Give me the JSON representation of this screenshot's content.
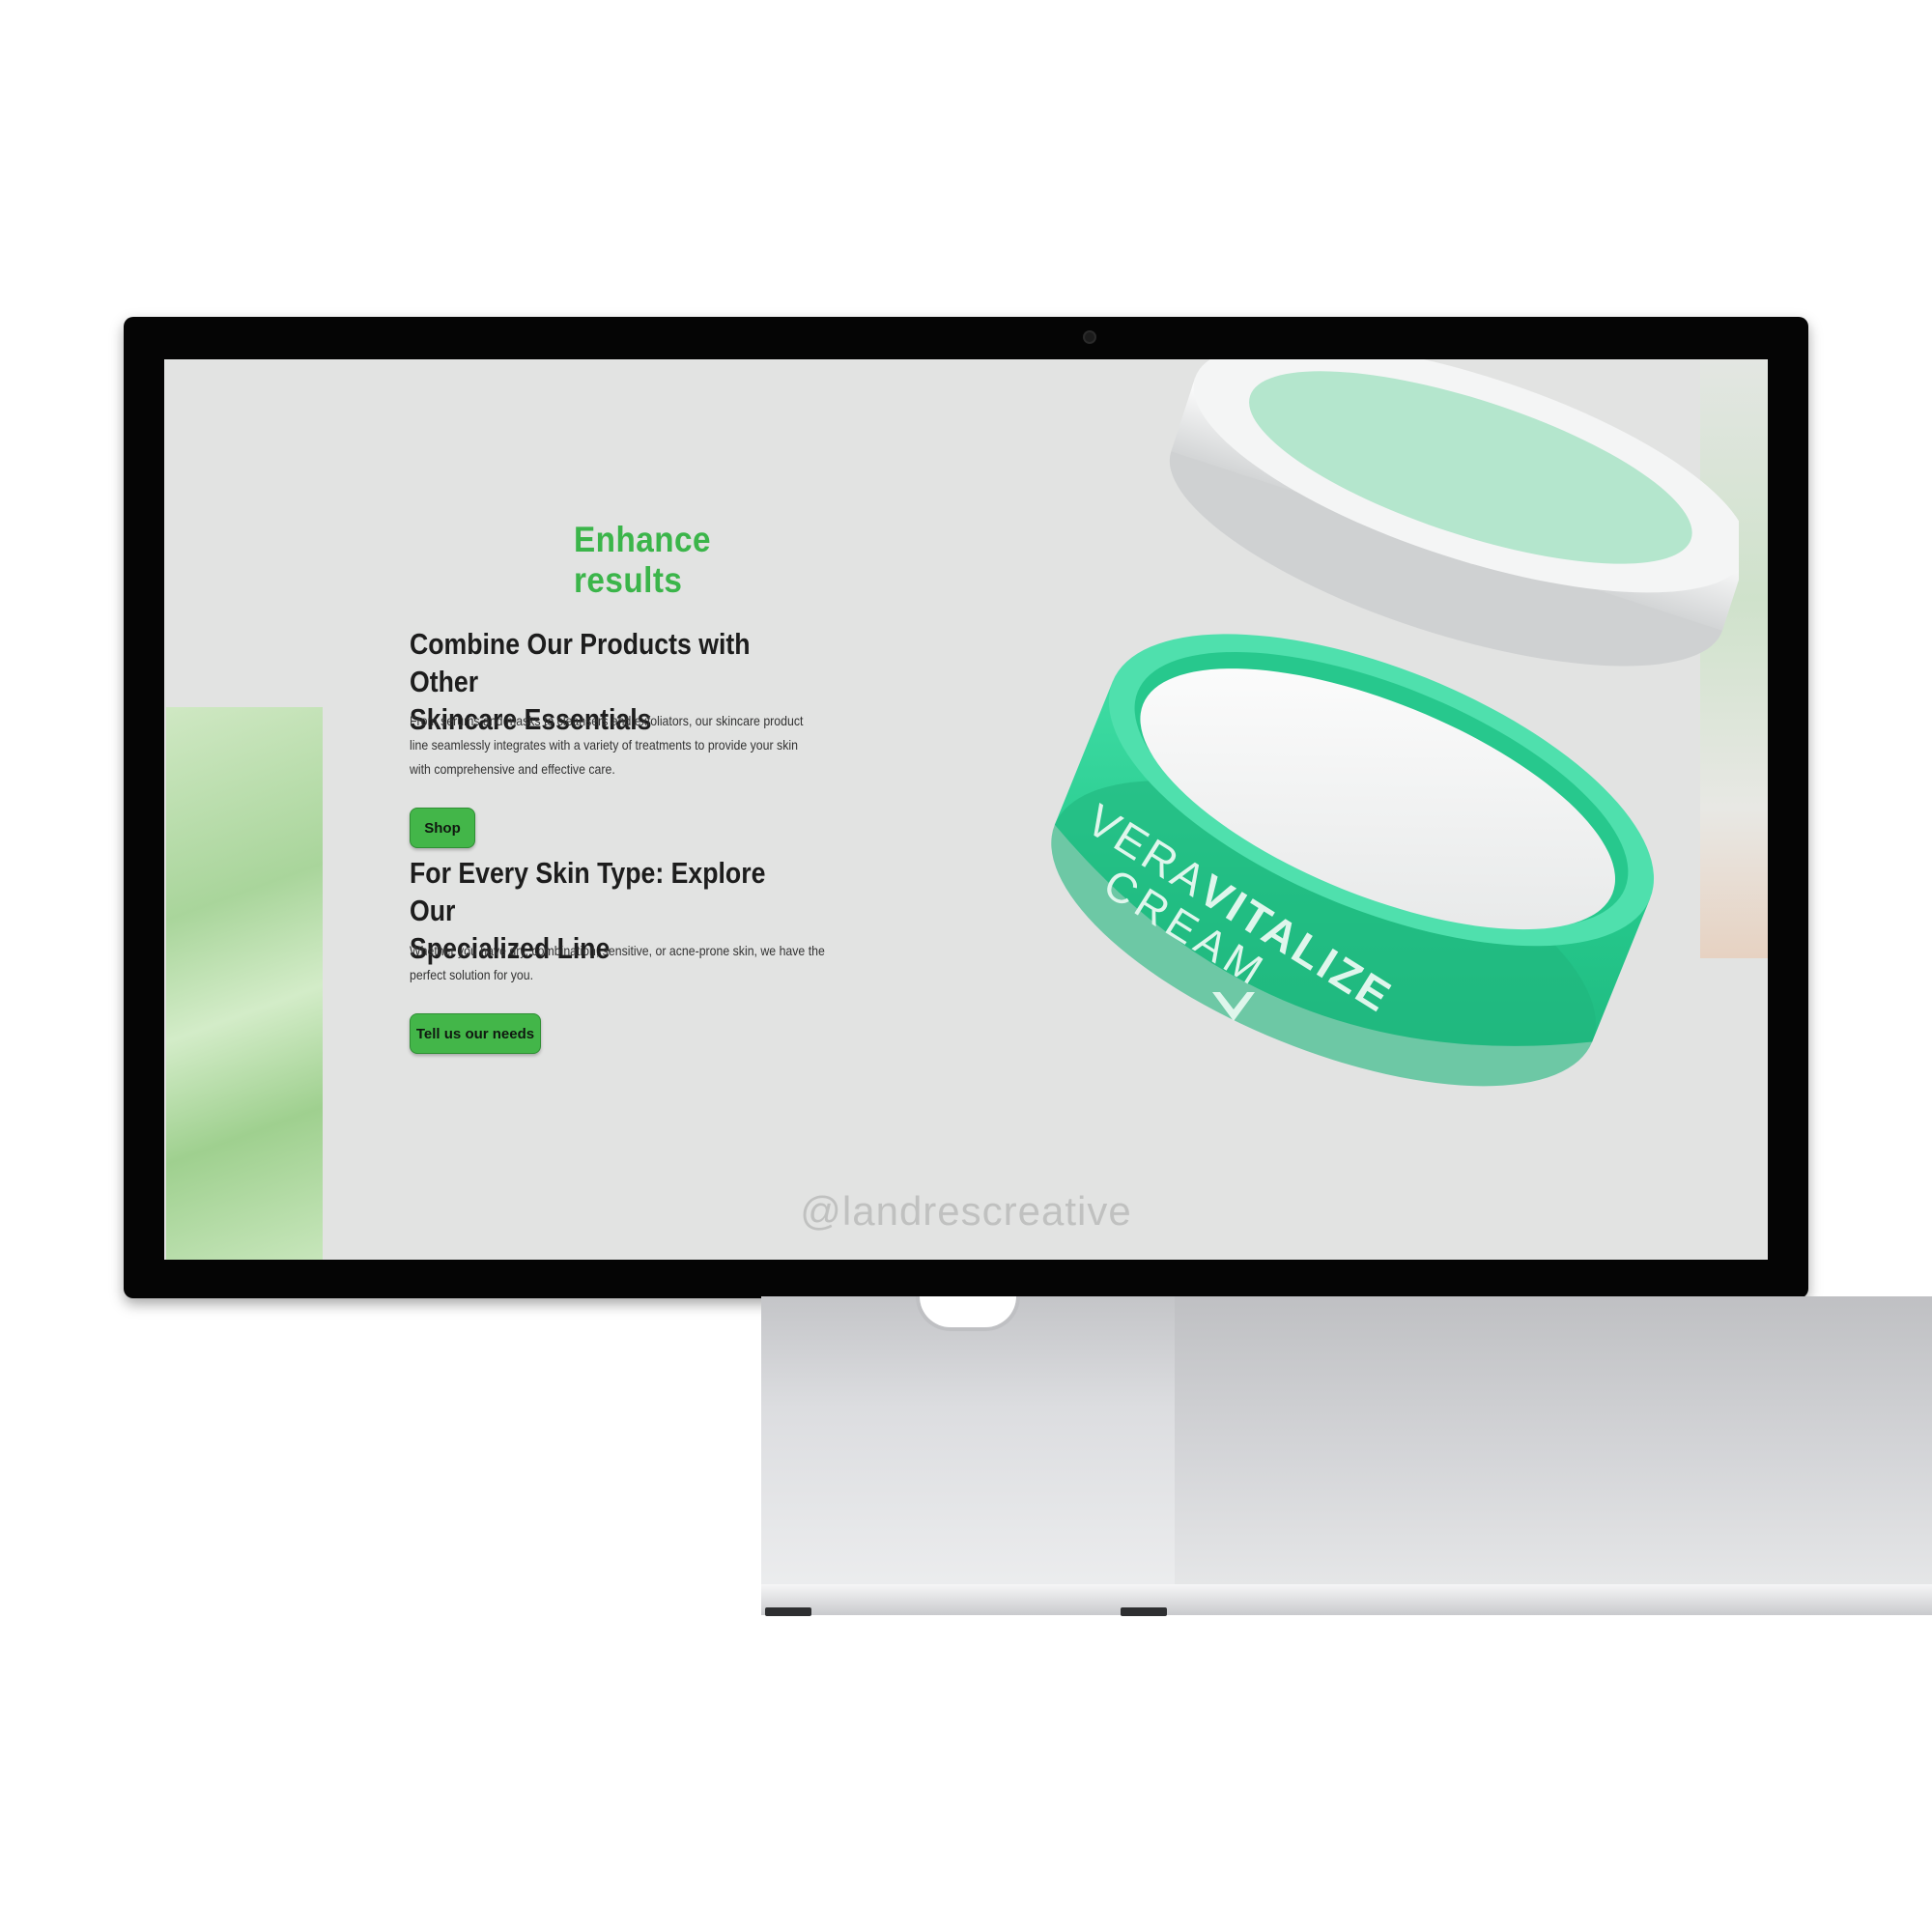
{
  "content": {
    "section_title": "Enhance results",
    "blocks": [
      {
        "title_line1": "Combine Our Products with Other",
        "title_line2": "Skincare Essentials",
        "body_line1": "From serums and masks to cleansers and exfoliators, our skincare product",
        "body_line2": "line seamlessly integrates with a variety of treatments to provide your skin",
        "body_line3": "with comprehensive and effective care.",
        "button_label": "Shop"
      },
      {
        "title_line1": "For Every Skin Type: Explore Our",
        "title_line2": "Specialized Line",
        "body_line1": "Whether you have dry, combination, sensitive, or acne-prone skin, we have the",
        "body_line2": "perfect solution for you.",
        "button_label": "Tell us our needs"
      }
    ]
  },
  "product": {
    "brand_line1_a": "VERA",
    "brand_line1_b": "VITALIZE",
    "brand_line2": "CREAM"
  },
  "watermark": "@landrescreative",
  "colors": {
    "accent_green": "#3bb54a",
    "jar_green": "#2fcf93",
    "screen_bg": "#e2e3e2"
  }
}
